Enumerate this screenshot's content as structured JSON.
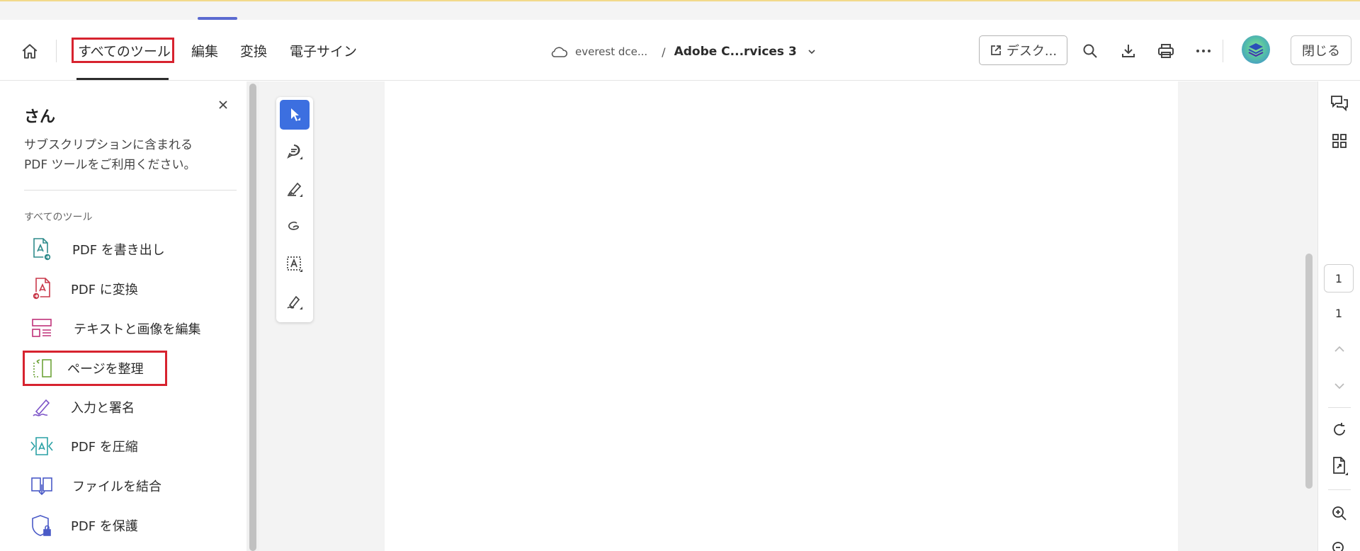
{
  "header": {
    "nav_tabs": [
      {
        "label": "すべてのツール",
        "active": true
      },
      {
        "label": "編集"
      },
      {
        "label": "変換"
      },
      {
        "label": "電子サイン"
      }
    ],
    "breadcrumb": {
      "root": "everest dce...",
      "separator": "/",
      "document": "Adobe C...rvices 3"
    },
    "desktop_button_label": "デスク...",
    "close_button_label": "閉じる",
    "icons": [
      "home-icon",
      "cloud-icon",
      "chevron-down-icon",
      "external-link-icon",
      "search-icon",
      "download-icon",
      "print-icon",
      "more-icon",
      "avatar"
    ]
  },
  "left_panel": {
    "greeting": "さん",
    "subtitle_line1": "サブスクリプションに含まれる",
    "subtitle_line2": "PDF ツールをご利用ください。",
    "section_title": "すべてのツール",
    "tools": [
      {
        "label": "PDF を書き出し",
        "icon": "export-pdf-icon"
      },
      {
        "label": "PDF に変換",
        "icon": "create-pdf-icon"
      },
      {
        "label": "テキストと画像を編集",
        "icon": "edit-text-image-icon"
      },
      {
        "label": "ページを整理",
        "icon": "organize-pages-icon",
        "highlighted": true
      },
      {
        "label": "入力と署名",
        "icon": "fill-sign-icon"
      },
      {
        "label": "PDF を圧縮",
        "icon": "compress-pdf-icon"
      },
      {
        "label": "ファイルを結合",
        "icon": "combine-files-icon"
      },
      {
        "label": "PDF を保護",
        "icon": "protect-pdf-icon"
      }
    ]
  },
  "quick_tools": [
    "select-cursor-icon",
    "comment-icon",
    "highlight-icon",
    "draw-icon",
    "text-select-icon",
    "sign-icon"
  ],
  "right_rail": {
    "current_page": "1",
    "total_pages": "1",
    "icons": [
      "comments-icon",
      "grid-icon",
      "chevron-up-icon",
      "chevron-down-icon",
      "rotate-icon",
      "page-extract-icon",
      "zoom-in-icon",
      "zoom-out-icon"
    ]
  },
  "colors": {
    "highlight_border": "#d7232f",
    "accent_blue": "#3c6fe0",
    "tab_indicator": "#5b6ad0"
  }
}
